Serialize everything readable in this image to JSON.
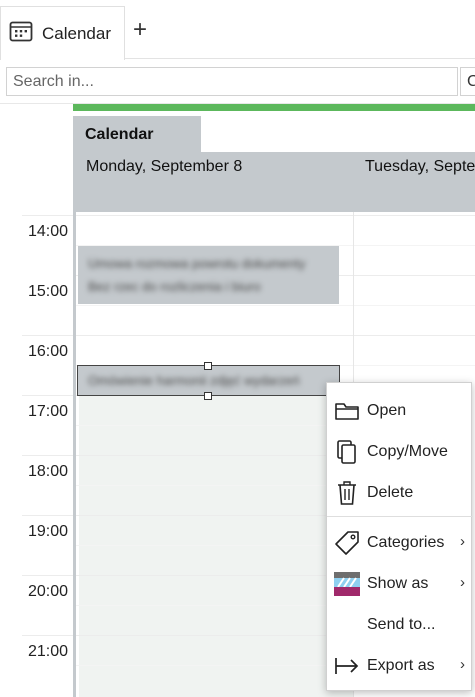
{
  "tabs": [
    {
      "label": "Calendar",
      "icon": "calendar-icon"
    }
  ],
  "add_tab_label": "+",
  "search": {
    "placeholder": "Search in...",
    "button_label": "C"
  },
  "calendar": {
    "name": "Calendar",
    "days": [
      "Monday, September 8",
      "Tuesday, Septe"
    ],
    "hours": [
      "14:00",
      "15:00",
      "16:00",
      "17:00",
      "18:00",
      "19:00",
      "20:00",
      "21:00"
    ],
    "accent_color": "#5cb85c",
    "header_color": "#c4c9cd"
  },
  "events": [
    {
      "lines": [
        "Umowa rozmowa powrotu dokumenty",
        "Bez rzec do rozliczenia i biuro"
      ]
    },
    {
      "lines": [
        "Omówienie harmonii zdjęć wydarzeń"
      ]
    }
  ],
  "context_menu": {
    "items": [
      {
        "label": "Open",
        "icon": "folder-icon",
        "submenu": false
      },
      {
        "label": "Copy/Move",
        "icon": "copy-icon",
        "submenu": false
      },
      {
        "label": "Delete",
        "icon": "trash-icon",
        "submenu": false
      },
      {
        "label": "Categories",
        "icon": "tag-icon",
        "submenu": true
      },
      {
        "label": "Show as",
        "icon": "show-as-icon",
        "submenu": true
      },
      {
        "label": "Send to...",
        "icon": "",
        "submenu": false
      },
      {
        "label": "Export as",
        "icon": "export-arrow-icon",
        "submenu": true
      }
    ],
    "chevron": "›"
  }
}
